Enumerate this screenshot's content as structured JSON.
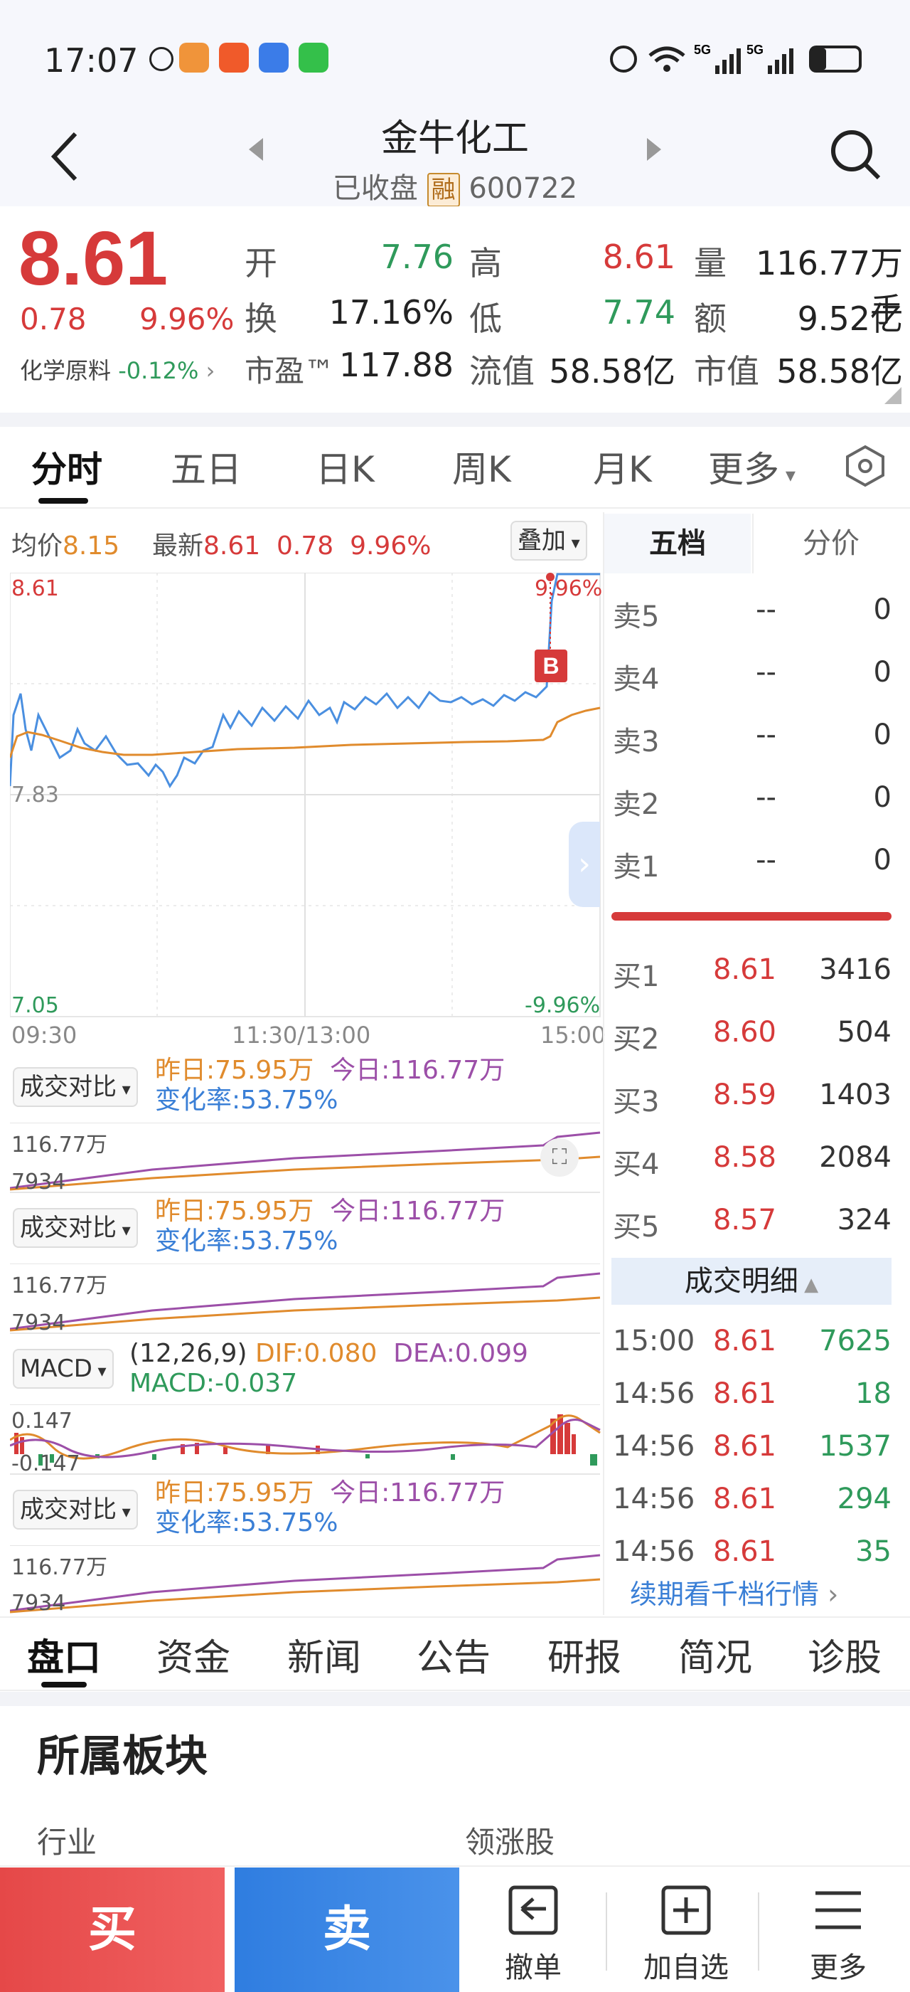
{
  "status": {
    "time": "17:07"
  },
  "header": {
    "name": "金牛化工",
    "state": "已收盘",
    "rong": "融",
    "code": "600722"
  },
  "quote": {
    "price": "8.61",
    "change": "0.78",
    "pct": "9.96%",
    "sector": "化学原料",
    "sector_pct": "-0.12%",
    "open_label": "开",
    "open": "7.76",
    "high_label": "高",
    "high": "8.61",
    "vol_label": "量",
    "vol": "116.77万手",
    "turn_label": "换",
    "turn": "17.16%",
    "low_label": "低",
    "low": "7.74",
    "amt_label": "额",
    "amt": "9.52亿",
    "pe_label": "市盈™",
    "pe": "117.88",
    "float_label": "流值",
    "float": "58.58亿",
    "mcap_label": "市值",
    "mcap": "58.58亿"
  },
  "tabs": [
    "分时",
    "五日",
    "日K",
    "周K",
    "月K",
    "更多"
  ],
  "chart": {
    "avg_label": "均价",
    "avg": "8.15",
    "latest_label": "最新",
    "latest": "8.61",
    "latest_chg": "0.78",
    "latest_pct": "9.96%",
    "overlay": "叠加",
    "y_top": "8.61",
    "y_mid": "7.83",
    "y_bot": "7.05",
    "pct_top": "9.96%",
    "pct_bot": "-9.96%",
    "x_start": "09:30",
    "x_mid": "11:30/13:00",
    "x_end": "15:00",
    "marker": "B"
  },
  "indicators": [
    {
      "btn": "成交对比",
      "yest": "昨日:75.95万",
      "today": "今日:116.77万",
      "rate": "变化率:53.75%",
      "ymax": "116.77万",
      "ymin": "7934"
    },
    {
      "btn": "成交对比",
      "yest": "昨日:75.95万",
      "today": "今日:116.77万",
      "rate": "变化率:53.75%",
      "ymax": "116.77万",
      "ymin": "7934"
    },
    {
      "btn": "MACD",
      "param": "(12,26,9)",
      "dif": "DIF:0.080",
      "dea": "DEA:0.099",
      "macd": "MACD:-0.037",
      "ymax": "0.147",
      "ymin": "-0.147"
    },
    {
      "btn": "成交对比",
      "yest": "昨日:75.95万",
      "today": "今日:116.77万",
      "rate": "变化率:53.75%",
      "ymax": "116.77万",
      "ymin": "7934"
    }
  ],
  "orderbook": {
    "tab1": "五档",
    "tab2": "分价",
    "sells": [
      {
        "label": "卖5",
        "price": "--",
        "vol": "0"
      },
      {
        "label": "卖4",
        "price": "--",
        "vol": "0"
      },
      {
        "label": "卖3",
        "price": "--",
        "vol": "0"
      },
      {
        "label": "卖2",
        "price": "--",
        "vol": "0"
      },
      {
        "label": "卖1",
        "price": "--",
        "vol": "0"
      }
    ],
    "buys": [
      {
        "label": "买1",
        "price": "8.61",
        "vol": "3416"
      },
      {
        "label": "买2",
        "price": "8.60",
        "vol": "504"
      },
      {
        "label": "买3",
        "price": "8.59",
        "vol": "1403"
      },
      {
        "label": "买4",
        "price": "8.58",
        "vol": "2084"
      },
      {
        "label": "买5",
        "price": "8.57",
        "vol": "324"
      }
    ],
    "detail_title": "成交明细",
    "details": [
      {
        "time": "15:00",
        "price": "8.61",
        "vol": "7625"
      },
      {
        "time": "14:56",
        "price": "8.61",
        "vol": "18"
      },
      {
        "time": "14:56",
        "price": "8.61",
        "vol": "1537"
      },
      {
        "time": "14:56",
        "price": "8.61",
        "vol": "294"
      },
      {
        "time": "14:56",
        "price": "8.61",
        "vol": "35"
      }
    ],
    "more_link": "续期看千档行情"
  },
  "bottom_tabs": [
    "盘口",
    "资金",
    "新闻",
    "公告",
    "研报",
    "简况",
    "诊股"
  ],
  "section": {
    "title": "所属板块",
    "col1": "行业",
    "col2": "领涨股"
  },
  "actions": {
    "buy": "买",
    "sell": "卖",
    "cancel": "撤单",
    "watch": "加自选",
    "more": "更多"
  },
  "colors": {
    "up": "#d63a3a",
    "down": "#2f9a5b",
    "price_line": "#4a8fe0",
    "avg_line": "#e08b2d"
  }
}
